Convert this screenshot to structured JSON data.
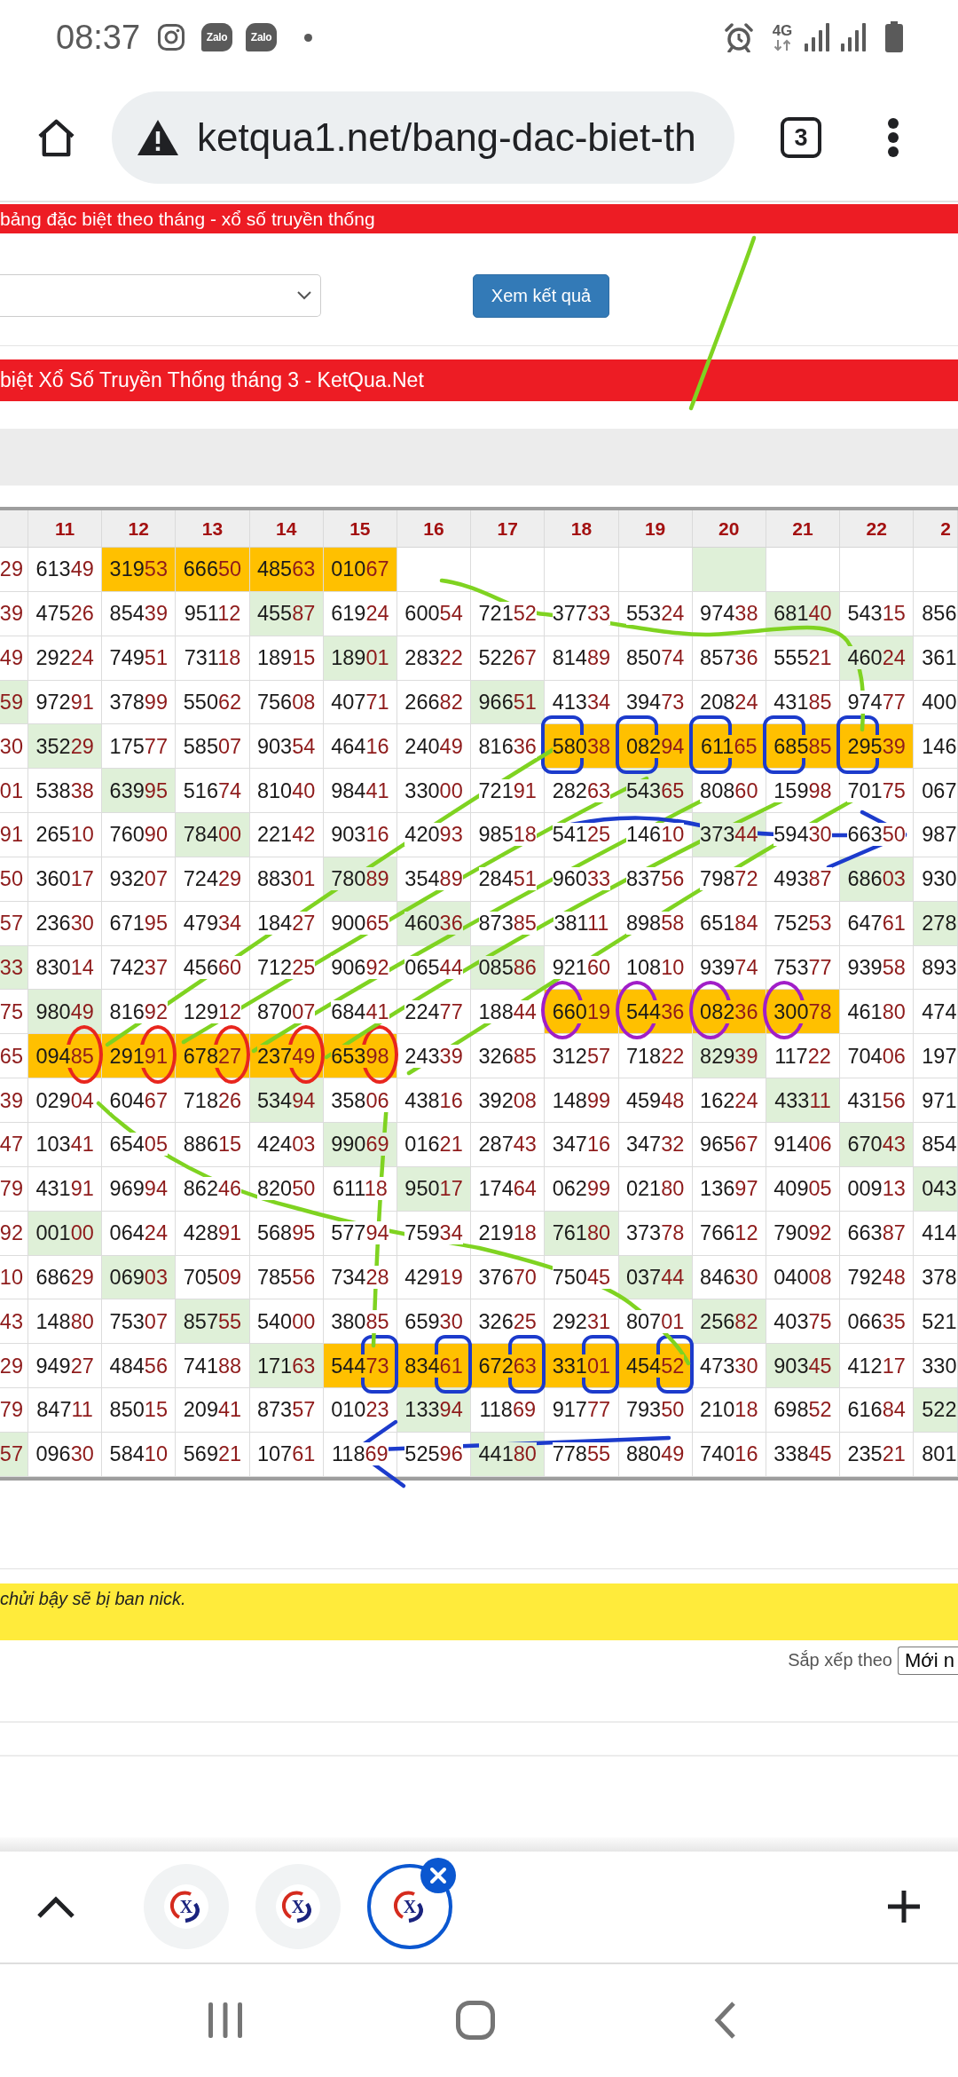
{
  "status_bar": {
    "time": "08:37",
    "notifications": [
      {
        "kind": "camera"
      },
      {
        "kind": "chat",
        "label": "Zalo"
      },
      {
        "kind": "chat",
        "label": "Zalo"
      },
      {
        "kind": "dot"
      }
    ],
    "network": "4G"
  },
  "browser_toolbar": {
    "url": "ketqua1.net/bang-dac-biet-th",
    "tab_count": "3"
  },
  "page_banner": "bảng đặc biệt theo tháng - xổ số truyền thống",
  "form": {
    "submit_button": "Xem kết quả"
  },
  "table_title": "biệt Xổ Số Truyền Thống tháng 3 - KetQua.Net",
  "table": {
    "columns": [
      {},
      {
        "label": "11"
      },
      {
        "label": "12"
      },
      {
        "label": "13"
      },
      {
        "label": "14"
      },
      {
        "label": "15"
      },
      {
        "label": "16"
      },
      {
        "label": "17"
      },
      {
        "label": "18"
      },
      {
        "label": "19"
      },
      {
        "label": "20"
      },
      {
        "label": "21"
      },
      {
        "label": "22"
      },
      {
        "label": "2"
      }
    ],
    "rows": [
      [
        {
          "tail": "29"
        },
        {
          "head": "613",
          "tail": "49"
        },
        {
          "head": "319",
          "tail": "53",
          "color": "#ffc000"
        },
        {
          "head": "666",
          "tail": "50",
          "color": "#ffc000"
        },
        {
          "head": "485",
          "tail": "63",
          "color": "#ffc000"
        },
        {
          "head": "010",
          "tail": "67",
          "color": "#ffc000"
        },
        {},
        {},
        {},
        {},
        {
          "color": "#dff0d8"
        },
        {},
        {},
        {}
      ],
      [
        {
          "tail": "39"
        },
        {
          "head": "475",
          "tail": "26"
        },
        {
          "head": "854",
          "tail": "39"
        },
        {
          "head": "951",
          "tail": "12"
        },
        {
          "head": "455",
          "tail": "87",
          "color": "#dff0d8"
        },
        {
          "head": "619",
          "tail": "24"
        },
        {
          "head": "600",
          "tail": "54"
        },
        {
          "head": "721",
          "tail": "52"
        },
        {
          "head": "377",
          "tail": "33"
        },
        {
          "head": "553",
          "tail": "24"
        },
        {
          "head": "974",
          "tail": "38"
        },
        {
          "head": "681",
          "tail": "40",
          "color": "#dff0d8"
        },
        {
          "head": "543",
          "tail": "15"
        },
        {
          "head": "856"
        }
      ],
      [
        {
          "tail": "49"
        },
        {
          "head": "292",
          "tail": "24"
        },
        {
          "head": "749",
          "tail": "51"
        },
        {
          "head": "731",
          "tail": "18"
        },
        {
          "head": "189",
          "tail": "15"
        },
        {
          "head": "189",
          "tail": "01",
          "color": "#dff0d8"
        },
        {
          "head": "283",
          "tail": "22"
        },
        {
          "head": "522",
          "tail": "67"
        },
        {
          "head": "814",
          "tail": "89"
        },
        {
          "head": "850",
          "tail": "74"
        },
        {
          "head": "857",
          "tail": "36"
        },
        {
          "head": "555",
          "tail": "21"
        },
        {
          "head": "460",
          "tail": "24",
          "color": "#dff0d8"
        },
        {
          "head": "361"
        }
      ],
      [
        {
          "tail": "59",
          "color": "#dff0d8"
        },
        {
          "head": "972",
          "tail": "91"
        },
        {
          "head": "378",
          "tail": "99"
        },
        {
          "head": "550",
          "tail": "62"
        },
        {
          "head": "756",
          "tail": "08"
        },
        {
          "head": "407",
          "tail": "71"
        },
        {
          "head": "266",
          "tail": "82"
        },
        {
          "head": "966",
          "tail": "51",
          "color": "#dff0d8"
        },
        {
          "head": "413",
          "tail": "34"
        },
        {
          "head": "394",
          "tail": "73"
        },
        {
          "head": "208",
          "tail": "24"
        },
        {
          "head": "431",
          "tail": "85"
        },
        {
          "head": "974",
          "tail": "77"
        },
        {
          "head": "400"
        }
      ],
      [
        {
          "tail": "30"
        },
        {
          "head": "352",
          "tail": "29",
          "color": "#dff0d8"
        },
        {
          "head": "175",
          "tail": "77"
        },
        {
          "head": "585",
          "tail": "07"
        },
        {
          "head": "903",
          "tail": "54"
        },
        {
          "head": "464",
          "tail": "16"
        },
        {
          "head": "240",
          "tail": "49"
        },
        {
          "head": "816",
          "tail": "36"
        },
        {
          "head": "580",
          "tail": "38",
          "color": "#ffc000",
          "annotation": {
            "kind": "box",
            "color": "#1c3bcc",
            "last_digits": false
          }
        },
        {
          "head": "082",
          "tail": "94",
          "color": "#ffc000",
          "annotation": {
            "kind": "box",
            "color": "#1c3bcc",
            "last_digits": false
          }
        },
        {
          "head": "611",
          "tail": "65",
          "color": "#ffc000",
          "annotation": {
            "kind": "box",
            "color": "#1c3bcc",
            "last_digits": false
          }
        },
        {
          "head": "685",
          "tail": "85",
          "color": "#ffc000",
          "annotation": {
            "kind": "box",
            "color": "#1c3bcc",
            "last_digits": false
          }
        },
        {
          "head": "295",
          "tail": "39",
          "color": "#ffc000",
          "annotation": {
            "kind": "box",
            "color": "#1c3bcc",
            "last_digits": false
          }
        },
        {
          "head": "146"
        }
      ],
      [
        {
          "tail": "01"
        },
        {
          "head": "538",
          "tail": "38"
        },
        {
          "head": "639",
          "tail": "95",
          "color": "#dff0d8"
        },
        {
          "head": "516",
          "tail": "74"
        },
        {
          "head": "810",
          "tail": "40"
        },
        {
          "head": "984",
          "tail": "41"
        },
        {
          "head": "330",
          "tail": "00"
        },
        {
          "head": "721",
          "tail": "91"
        },
        {
          "head": "282",
          "tail": "63"
        },
        {
          "head": "543",
          "tail": "65",
          "color": "#dff0d8"
        },
        {
          "head": "808",
          "tail": "60"
        },
        {
          "head": "159",
          "tail": "98"
        },
        {
          "head": "701",
          "tail": "75"
        },
        {
          "head": "067"
        }
      ],
      [
        {
          "tail": "91"
        },
        {
          "head": "265",
          "tail": "10"
        },
        {
          "head": "760",
          "tail": "90"
        },
        {
          "head": "784",
          "tail": "00",
          "color": "#dff0d8"
        },
        {
          "head": "221",
          "tail": "42"
        },
        {
          "head": "903",
          "tail": "16"
        },
        {
          "head": "420",
          "tail": "93"
        },
        {
          "head": "985",
          "tail": "18"
        },
        {
          "head": "541",
          "tail": "25"
        },
        {
          "head": "146",
          "tail": "10"
        },
        {
          "head": "373",
          "tail": "44",
          "color": "#dff0d8"
        },
        {
          "head": "594",
          "tail": "30"
        },
        {
          "head": "663",
          "tail": "50"
        },
        {
          "head": "987"
        }
      ],
      [
        {
          "tail": "50"
        },
        {
          "head": "360",
          "tail": "17"
        },
        {
          "head": "932",
          "tail": "07"
        },
        {
          "head": "724",
          "tail": "29"
        },
        {
          "head": "883",
          "tail": "01"
        },
        {
          "head": "780",
          "tail": "89",
          "color": "#dff0d8"
        },
        {
          "head": "354",
          "tail": "89"
        },
        {
          "head": "284",
          "tail": "51"
        },
        {
          "head": "960",
          "tail": "33"
        },
        {
          "head": "837",
          "tail": "56"
        },
        {
          "head": "798",
          "tail": "72"
        },
        {
          "head": "493",
          "tail": "87"
        },
        {
          "head": "686",
          "tail": "03",
          "color": "#dff0d8"
        },
        {
          "head": "930"
        }
      ],
      [
        {
          "tail": "57"
        },
        {
          "head": "236",
          "tail": "30"
        },
        {
          "head": "671",
          "tail": "95"
        },
        {
          "head": "479",
          "tail": "34"
        },
        {
          "head": "184",
          "tail": "27"
        },
        {
          "head": "900",
          "tail": "65"
        },
        {
          "head": "460",
          "tail": "36",
          "color": "#dff0d8"
        },
        {
          "head": "873",
          "tail": "85"
        },
        {
          "head": "381",
          "tail": "11"
        },
        {
          "head": "898",
          "tail": "58"
        },
        {
          "head": "651",
          "tail": "84"
        },
        {
          "head": "752",
          "tail": "53"
        },
        {
          "head": "647",
          "tail": "61"
        },
        {
          "head": "278",
          "color": "#dff0d8"
        }
      ],
      [
        {
          "tail": "33",
          "color": "#dff0d8"
        },
        {
          "head": "830",
          "tail": "14"
        },
        {
          "head": "742",
          "tail": "37"
        },
        {
          "head": "456",
          "tail": "60"
        },
        {
          "head": "712",
          "tail": "25"
        },
        {
          "head": "906",
          "tail": "92"
        },
        {
          "head": "065",
          "tail": "44"
        },
        {
          "head": "085",
          "tail": "86",
          "color": "#dff0d8"
        },
        {
          "head": "921",
          "tail": "60"
        },
        {
          "head": "108",
          "tail": "10"
        },
        {
          "head": "939",
          "tail": "74"
        },
        {
          "head": "753",
          "tail": "77"
        },
        {
          "head": "939",
          "tail": "58"
        },
        {
          "head": "893"
        }
      ],
      [
        {
          "tail": "75"
        },
        {
          "head": "980",
          "tail": "49",
          "color": "#dff0d8"
        },
        {
          "head": "816",
          "tail": "92"
        },
        {
          "head": "129",
          "tail": "12"
        },
        {
          "head": "870",
          "tail": "07"
        },
        {
          "head": "684",
          "tail": "41"
        },
        {
          "head": "224",
          "tail": "77"
        },
        {
          "head": "188",
          "tail": "44"
        },
        {
          "head": "660",
          "tail": "19",
          "color": "#ffc000",
          "annotation": {
            "kind": "circle",
            "color": "#a11ec8",
            "last_digits": false
          }
        },
        {
          "head": "544",
          "tail": "36",
          "color": "#ffc000",
          "annotation": {
            "kind": "circle",
            "color": "#a11ec8",
            "last_digits": false
          }
        },
        {
          "head": "082",
          "tail": "36",
          "color": "#ffc000",
          "annotation": {
            "kind": "circle",
            "color": "#a11ec8",
            "last_digits": false
          }
        },
        {
          "head": "300",
          "tail": "78",
          "color": "#ffc000",
          "annotation": {
            "kind": "circle",
            "color": "#a11ec8",
            "last_digits": false
          }
        },
        {
          "head": "461",
          "tail": "80"
        },
        {
          "head": "474"
        }
      ],
      [
        {
          "tail": "65"
        },
        {
          "head": "094",
          "tail": "85",
          "color": "#ffc000",
          "annotation": {
            "kind": "circle",
            "color": "#e8261e",
            "last_digits": true
          }
        },
        {
          "head": "291",
          "tail": "91",
          "color": "#ffc000",
          "annotation": {
            "kind": "circle",
            "color": "#e8261e",
            "last_digits": true
          }
        },
        {
          "head": "678",
          "tail": "27",
          "color": "#ffc000",
          "annotation": {
            "kind": "circle",
            "color": "#e8261e",
            "last_digits": true
          }
        },
        {
          "head": "237",
          "tail": "49",
          "color": "#ffc000",
          "annotation": {
            "kind": "circle",
            "color": "#e8261e",
            "last_digits": true
          }
        },
        {
          "head": "653",
          "tail": "98",
          "color": "#ffc000",
          "annotation": {
            "kind": "circle",
            "color": "#e8261e",
            "last_digits": true
          }
        },
        {
          "head": "243",
          "tail": "39"
        },
        {
          "head": "326",
          "tail": "85"
        },
        {
          "head": "312",
          "tail": "57"
        },
        {
          "head": "718",
          "tail": "22"
        },
        {
          "head": "829",
          "tail": "39",
          "color": "#dff0d8"
        },
        {
          "head": "117",
          "tail": "22"
        },
        {
          "head": "704",
          "tail": "06"
        },
        {
          "head": "197"
        }
      ],
      [
        {
          "tail": "39"
        },
        {
          "head": "029",
          "tail": "04"
        },
        {
          "head": "604",
          "tail": "67"
        },
        {
          "head": "718",
          "tail": "26"
        },
        {
          "head": "534",
          "tail": "94",
          "color": "#dff0d8"
        },
        {
          "head": "358",
          "tail": "06"
        },
        {
          "head": "438",
          "tail": "16"
        },
        {
          "head": "392",
          "tail": "08"
        },
        {
          "head": "148",
          "tail": "99"
        },
        {
          "head": "459",
          "tail": "48"
        },
        {
          "head": "162",
          "tail": "24"
        },
        {
          "head": "433",
          "tail": "11",
          "color": "#dff0d8"
        },
        {
          "head": "431",
          "tail": "56"
        },
        {
          "head": "971"
        }
      ],
      [
        {
          "tail": "47"
        },
        {
          "head": "103",
          "tail": "41"
        },
        {
          "head": "654",
          "tail": "05"
        },
        {
          "head": "886",
          "tail": "15"
        },
        {
          "head": "424",
          "tail": "03"
        },
        {
          "head": "990",
          "tail": "69",
          "color": "#dff0d8"
        },
        {
          "head": "016",
          "tail": "21"
        },
        {
          "head": "287",
          "tail": "43"
        },
        {
          "head": "347",
          "tail": "16"
        },
        {
          "head": "347",
          "tail": "32"
        },
        {
          "head": "965",
          "tail": "67"
        },
        {
          "head": "914",
          "tail": "06"
        },
        {
          "head": "670",
          "tail": "43",
          "color": "#dff0d8"
        },
        {
          "head": "854"
        }
      ],
      [
        {
          "tail": "79"
        },
        {
          "head": "431",
          "tail": "91"
        },
        {
          "head": "969",
          "tail": "94"
        },
        {
          "head": "862",
          "tail": "46"
        },
        {
          "head": "820",
          "tail": "50"
        },
        {
          "head": "611",
          "tail": "18"
        },
        {
          "head": "950",
          "tail": "17",
          "color": "#dff0d8"
        },
        {
          "head": "174",
          "tail": "64"
        },
        {
          "head": "062",
          "tail": "99"
        },
        {
          "head": "021",
          "tail": "80"
        },
        {
          "head": "136",
          "tail": "97"
        },
        {
          "head": "409",
          "tail": "05"
        },
        {
          "head": "009",
          "tail": "13"
        },
        {
          "head": "043",
          "color": "#dff0d8"
        }
      ],
      [
        {
          "tail": "92"
        },
        {
          "head": "001",
          "tail": "00",
          "color": "#dff0d8"
        },
        {
          "head": "064",
          "tail": "24"
        },
        {
          "head": "428",
          "tail": "91"
        },
        {
          "head": "568",
          "tail": "95"
        },
        {
          "head": "577",
          "tail": "94"
        },
        {
          "head": "759",
          "tail": "34"
        },
        {
          "head": "219",
          "tail": "18"
        },
        {
          "head": "761",
          "tail": "80",
          "color": "#dff0d8"
        },
        {
          "head": "373",
          "tail": "78"
        },
        {
          "head": "766",
          "tail": "12"
        },
        {
          "head": "790",
          "tail": "92"
        },
        {
          "head": "663",
          "tail": "87"
        },
        {
          "head": "414"
        }
      ],
      [
        {
          "tail": "10"
        },
        {
          "head": "686",
          "tail": "29"
        },
        {
          "head": "069",
          "tail": "03",
          "color": "#dff0d8"
        },
        {
          "head": "705",
          "tail": "09"
        },
        {
          "head": "785",
          "tail": "56"
        },
        {
          "head": "734",
          "tail": "28"
        },
        {
          "head": "429",
          "tail": "19"
        },
        {
          "head": "376",
          "tail": "70"
        },
        {
          "head": "750",
          "tail": "45"
        },
        {
          "head": "037",
          "tail": "44",
          "color": "#dff0d8"
        },
        {
          "head": "846",
          "tail": "30"
        },
        {
          "head": "040",
          "tail": "08"
        },
        {
          "head": "792",
          "tail": "48"
        },
        {
          "head": "378"
        }
      ],
      [
        {
          "tail": "43"
        },
        {
          "head": "148",
          "tail": "80"
        },
        {
          "head": "753",
          "tail": "07"
        },
        {
          "head": "857",
          "tail": "55",
          "color": "#dff0d8"
        },
        {
          "head": "540",
          "tail": "00"
        },
        {
          "head": "380",
          "tail": "85"
        },
        {
          "head": "659",
          "tail": "30"
        },
        {
          "head": "326",
          "tail": "25"
        },
        {
          "head": "292",
          "tail": "31"
        },
        {
          "head": "807",
          "tail": "01"
        },
        {
          "head": "256",
          "tail": "82",
          "color": "#dff0d8"
        },
        {
          "head": "403",
          "tail": "75"
        },
        {
          "head": "066",
          "tail": "35"
        },
        {
          "head": "521"
        }
      ],
      [
        {
          "tail": "29"
        },
        {
          "head": "949",
          "tail": "27"
        },
        {
          "head": "484",
          "tail": "56"
        },
        {
          "head": "741",
          "tail": "88"
        },
        {
          "head": "171",
          "tail": "63",
          "color": "#dff0d8"
        },
        {
          "head": "544",
          "tail": "73",
          "color": "#ffc000",
          "annotation": {
            "kind": "box",
            "color": "#1c3bcc",
            "last_digits": true
          }
        },
        {
          "head": "834",
          "tail": "61",
          "color": "#ffc000",
          "annotation": {
            "kind": "box",
            "color": "#1c3bcc",
            "last_digits": true
          }
        },
        {
          "head": "672",
          "tail": "63",
          "color": "#ffc000",
          "annotation": {
            "kind": "box",
            "color": "#1c3bcc",
            "last_digits": true
          }
        },
        {
          "head": "331",
          "tail": "01",
          "color": "#ffc000",
          "annotation": {
            "kind": "box",
            "color": "#1c3bcc",
            "last_digits": true
          }
        },
        {
          "head": "454",
          "tail": "52",
          "color": "#ffc000",
          "annotation": {
            "kind": "box",
            "color": "#1c3bcc",
            "last_digits": true
          }
        },
        {
          "head": "473",
          "tail": "30"
        },
        {
          "head": "903",
          "tail": "45",
          "color": "#dff0d8"
        },
        {
          "head": "412",
          "tail": "17"
        },
        {
          "head": "330"
        }
      ],
      [
        {
          "tail": "79"
        },
        {
          "head": "847",
          "tail": "11"
        },
        {
          "head": "850",
          "tail": "15"
        },
        {
          "head": "209",
          "tail": "41"
        },
        {
          "head": "873",
          "tail": "57"
        },
        {
          "head": "010",
          "tail": "23"
        },
        {
          "head": "133",
          "tail": "94",
          "color": "#dff0d8"
        },
        {
          "head": "118",
          "tail": "69"
        },
        {
          "head": "917",
          "tail": "77"
        },
        {
          "head": "793",
          "tail": "50"
        },
        {
          "head": "210",
          "tail": "18"
        },
        {
          "head": "698",
          "tail": "52"
        },
        {
          "head": "616",
          "tail": "84"
        },
        {
          "head": "522",
          "color": "#dff0d8"
        }
      ],
      [
        {
          "tail": "57",
          "color": "#dff0d8"
        },
        {
          "head": "096",
          "tail": "30"
        },
        {
          "head": "584",
          "tail": "10"
        },
        {
          "head": "569",
          "tail": "21"
        },
        {
          "head": "107",
          "tail": "61"
        },
        {
          "head": "118",
          "tail": "69"
        },
        {
          "head": "525",
          "tail": "96"
        },
        {
          "head": "441",
          "tail": "80",
          "color": "#dff0d8"
        },
        {
          "head": "778",
          "tail": "55"
        },
        {
          "head": "880",
          "tail": "49"
        },
        {
          "head": "740",
          "tail": "16"
        },
        {
          "head": "338",
          "tail": "45"
        },
        {
          "head": "235",
          "tail": "21"
        },
        {
          "head": "801"
        }
      ]
    ]
  },
  "notice": "chửi bậy sẽ bị ban nick.",
  "sort": {
    "label": "Sắp xếp theo",
    "value": "Mới n"
  },
  "tab_strip": {
    "tabs": [
      {
        "logo_text": "X",
        "selected": false
      },
      {
        "logo_text": "X",
        "selected": false
      },
      {
        "logo_text": "X",
        "selected": true
      }
    ]
  }
}
